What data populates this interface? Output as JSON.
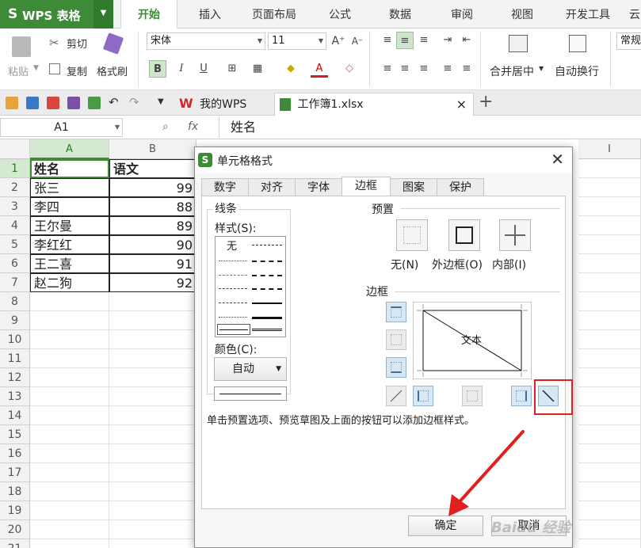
{
  "app": {
    "logo_char": "S",
    "title": "WPS 表格",
    "caret": "▼"
  },
  "ribbon_tabs": [
    "开始",
    "插入",
    "页面布局",
    "公式",
    "数据",
    "审阅",
    "视图",
    "开发工具",
    "云"
  ],
  "ribbon": {
    "paste": "粘贴",
    "cut": "剪切",
    "copy": "复制",
    "format_painter": "格式刷",
    "font_name": "宋体",
    "font_size": "11",
    "bold": "B",
    "italic": "I",
    "underline": "U",
    "merge_center": "合并居中",
    "wrap_text": "自动换行",
    "number_format": "常规"
  },
  "toolbar": {
    "file_tabs": [
      {
        "label": "我的WPS",
        "active": false
      },
      {
        "label": "工作簿1.xlsx",
        "active": true
      }
    ],
    "add_tab": "+",
    "close": "×"
  },
  "formula_bar": {
    "cell_ref": "A1",
    "fx": "fx",
    "content": "姓名"
  },
  "sheet": {
    "columns": [
      "A",
      "B",
      "I"
    ],
    "rows": [
      "1",
      "2",
      "3",
      "4",
      "5",
      "6",
      "7",
      "8",
      "9",
      "10",
      "11",
      "12",
      "13",
      "14",
      "15",
      "16",
      "17",
      "18",
      "19",
      "20",
      "21"
    ],
    "data": [
      [
        "姓名",
        "语文"
      ],
      [
        "张三",
        "99"
      ],
      [
        "李四",
        "88"
      ],
      [
        "王尔曼",
        "89"
      ],
      [
        "李红红",
        "90"
      ],
      [
        "王二喜",
        "91"
      ],
      [
        "赵二狗",
        "92"
      ]
    ]
  },
  "dialog": {
    "title": "单元格格式",
    "close": "✕",
    "tabs": [
      "数字",
      "对齐",
      "字体",
      "边框",
      "图案",
      "保护"
    ],
    "active_tab": "边框",
    "line_group": "线条",
    "style_label": "样式(S):",
    "style_none": "无",
    "color_label": "颜色(C):",
    "color_value": "自动",
    "presets_label": "预置",
    "presets": [
      "无(N)",
      "外边框(O)",
      "内部(I)"
    ],
    "border_label": "边框",
    "preview_text": "文本",
    "hint": "单击预置选项、预览草图及上面的按钮可以添加边框样式。",
    "ok": "确定",
    "cancel": "取消"
  },
  "watermark": "Baidu 经验",
  "colors": {
    "brand": "#3d8b37",
    "highlight": "#e02020"
  }
}
